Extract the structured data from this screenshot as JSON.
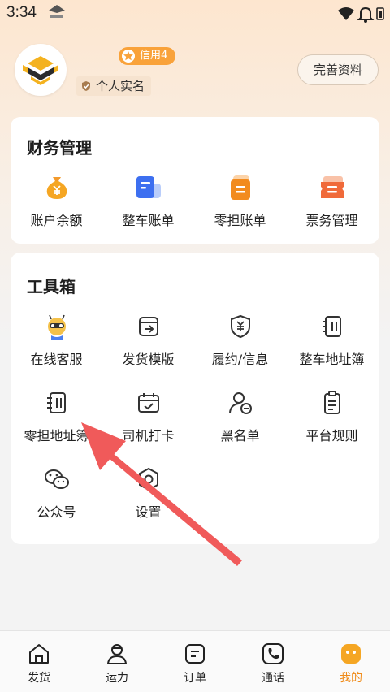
{
  "status_bar": {
    "time": "3:34",
    "icons": [
      "app-mini-icon",
      "wifi-icon",
      "battery-icon",
      "notification-bell-icon"
    ]
  },
  "profile": {
    "credit_label": "信用4",
    "auth_label": "个人实名",
    "complete_button": "完善资料"
  },
  "finance": {
    "title": "财务管理",
    "items": [
      {
        "label": "账户余额",
        "icon": "money-bag-icon"
      },
      {
        "label": "整车账单",
        "icon": "truck-bill-icon"
      },
      {
        "label": "零担账单",
        "icon": "ltl-bill-icon"
      },
      {
        "label": "票务管理",
        "icon": "ticket-icon"
      }
    ]
  },
  "tools": {
    "title": "工具箱",
    "items": [
      {
        "label": "在线客服",
        "icon": "bee-service-icon"
      },
      {
        "label": "发货模版",
        "icon": "template-icon"
      },
      {
        "label": "履约/信息",
        "icon": "yuan-shield-icon"
      },
      {
        "label": "整车地址簿",
        "icon": "address-book-icon"
      },
      {
        "label": "零担地址簿",
        "icon": "address-book-icon"
      },
      {
        "label": "司机打卡",
        "icon": "calendar-check-icon"
      },
      {
        "label": "黑名单",
        "icon": "user-block-icon"
      },
      {
        "label": "平台规则",
        "icon": "clipboard-icon"
      },
      {
        "label": "公众号",
        "icon": "wechat-icon"
      },
      {
        "label": "设置",
        "icon": "settings-icon"
      }
    ]
  },
  "bottom_nav": {
    "items": [
      {
        "label": "发货",
        "icon": "home-icon"
      },
      {
        "label": "运力",
        "icon": "driver-icon"
      },
      {
        "label": "订单",
        "icon": "order-icon"
      },
      {
        "label": "通话",
        "icon": "phone-icon"
      },
      {
        "label": "我的",
        "icon": "mine-icon"
      }
    ],
    "active": "我的"
  },
  "colors": {
    "accent": "#f08c1a",
    "badge": "#f9a23a",
    "arrow": "#f05a5a",
    "blue": "#4a7ff0"
  }
}
